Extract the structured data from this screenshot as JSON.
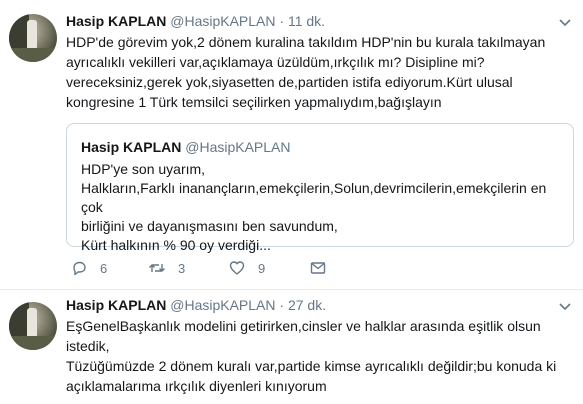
{
  "tweets": [
    {
      "author_name": "Hasip KAPLAN",
      "handle": "@HasipKAPLAN",
      "separator": "·",
      "time": "11 dk.",
      "lines": [
        "HDP'de görevim yok,2 dönem kuralina takıldım HDP'nin bu kurala takılmayan",
        "ayrıcalıklı vekilleri var,açıklamaya üzüldüm,ırkçılık mı? Disipline mi?",
        "vereceksiniz,gerek yok,siyasetten de,partiden istifa ediyorum.Kürt ulusal",
        "kongresine 1 Türk temsilci seçilirken yapmalıydım,bağışlayın"
      ],
      "quoted": {
        "author_name": "Hasip KAPLAN",
        "handle": "@HasipKAPLAN",
        "lines": [
          "HDP'ye son uyarım,",
          "Halkların,Farklı inanançların,emekçilerin,Solun,devrimcilerin,emekçilerin en çok",
          "birliğini ve dayanışmasını ben savundum,",
          "Kürt halkının  % 90  oy verdiği..."
        ]
      },
      "actions": {
        "reply_icon": "reply-icon",
        "reply_count": "6",
        "retweet_icon": "retweet-icon",
        "retweet_count": "3",
        "like_icon": "heart-icon",
        "like_count": "9",
        "dm_icon": "envelope-icon"
      }
    },
    {
      "author_name": "Hasip KAPLAN",
      "handle": "@HasipKAPLAN",
      "separator": "·",
      "time": "27 dk.",
      "lines": [
        "EşGenelBaşkanlık modelini getirirken,cinsler ve halklar arasında eşitlik olsun",
        "istedik,",
        "Tüzüğümüzde 2 dönem kuralı var,partide kimse ayrıcalıklı değildir;bu konuda ki",
        "açıklamalarıma ırkçılık diyenleri kınıyorum"
      ]
    }
  ],
  "colors": {
    "text": "#14171a",
    "muted": "#657786",
    "border": "#e6ecf0",
    "quote_border": "#ccd6dd"
  }
}
